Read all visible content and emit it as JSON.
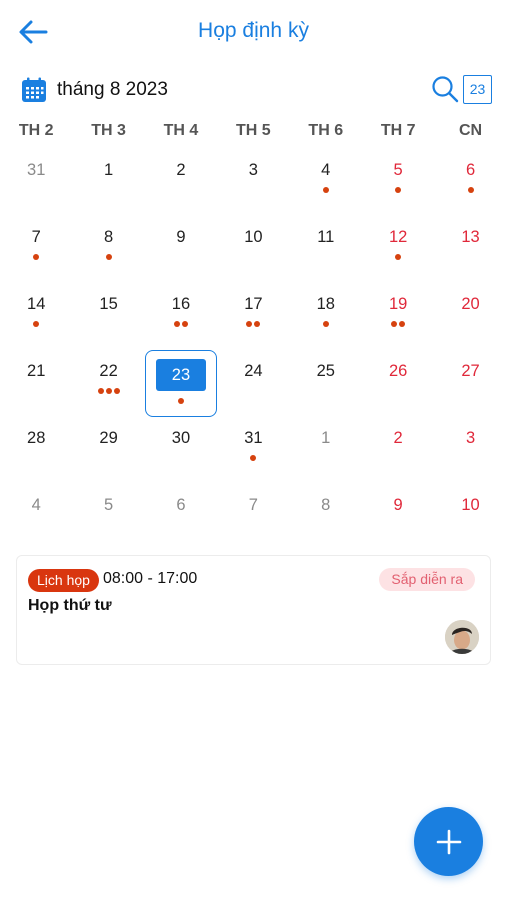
{
  "header": {
    "title": "Họp định kỳ"
  },
  "toolbar": {
    "month_label": "tháng 8 2023",
    "today_label": "23"
  },
  "weekdays": [
    "TH 2",
    "TH 3",
    "TH 4",
    "TH 5",
    "TH 6",
    "TH 7",
    "CN"
  ],
  "days": [
    {
      "n": "31",
      "muted": true,
      "dots": 0
    },
    {
      "n": "1",
      "dots": 0
    },
    {
      "n": "2",
      "dots": 0
    },
    {
      "n": "3",
      "dots": 0
    },
    {
      "n": "4",
      "dots": 1
    },
    {
      "n": "5",
      "dots": 1
    },
    {
      "n": "6",
      "dots": 1
    },
    {
      "n": "7",
      "dots": 1
    },
    {
      "n": "8",
      "dots": 1
    },
    {
      "n": "9",
      "dots": 0
    },
    {
      "n": "10",
      "dots": 0
    },
    {
      "n": "11",
      "dots": 0
    },
    {
      "n": "12",
      "dots": 1
    },
    {
      "n": "13",
      "dots": 0
    },
    {
      "n": "14",
      "dots": 1
    },
    {
      "n": "15",
      "dots": 0
    },
    {
      "n": "16",
      "dots": 2
    },
    {
      "n": "17",
      "dots": 2
    },
    {
      "n": "18",
      "dots": 1
    },
    {
      "n": "19",
      "dots": 2
    },
    {
      "n": "20",
      "dots": 0
    },
    {
      "n": "21",
      "dots": 0
    },
    {
      "n": "22",
      "dots": 3
    },
    {
      "n": "23",
      "dots": 1,
      "selected": true
    },
    {
      "n": "24",
      "dots": 0
    },
    {
      "n": "25",
      "dots": 0
    },
    {
      "n": "26",
      "dots": 0
    },
    {
      "n": "27",
      "dots": 0
    },
    {
      "n": "28",
      "dots": 0
    },
    {
      "n": "29",
      "dots": 0
    },
    {
      "n": "30",
      "dots": 0
    },
    {
      "n": "31",
      "dots": 1
    },
    {
      "n": "1",
      "muted": true,
      "dots": 0
    },
    {
      "n": "2",
      "muted": true,
      "dots": 0
    },
    {
      "n": "3",
      "muted": true,
      "dots": 0
    },
    {
      "n": "4",
      "muted": true,
      "dots": 0
    },
    {
      "n": "5",
      "muted": true,
      "dots": 0
    },
    {
      "n": "6",
      "muted": true,
      "dots": 0
    },
    {
      "n": "7",
      "muted": true,
      "dots": 0
    },
    {
      "n": "8",
      "muted": true,
      "dots": 0
    },
    {
      "n": "9",
      "muted": true,
      "dots": 0
    },
    {
      "n": "10",
      "muted": true,
      "dots": 0
    }
  ],
  "event": {
    "tag": "Lịch họp",
    "time": "08:00 - 17:00",
    "status": "Sắp diễn ra",
    "title": "Họp thứ tư"
  },
  "colors": {
    "accent": "#1a7fe0",
    "weekend": "#e0283a",
    "dot": "#d6420f",
    "tag": "#d9360f"
  },
  "icons": {
    "back": "arrow-left-icon",
    "calendar": "calendar-icon",
    "search": "search-icon",
    "add": "plus-icon"
  }
}
